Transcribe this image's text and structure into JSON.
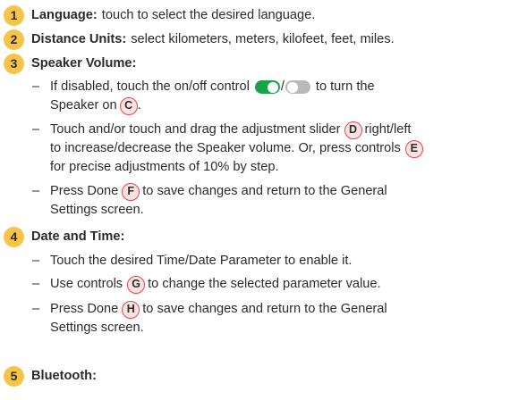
{
  "items": [
    {
      "num": "1",
      "title": "Language:",
      "desc": "touch to select the desired language."
    },
    {
      "num": "2",
      "title": "Distance Units:",
      "desc": "select kilometers, meters, kilofeet, feet, miles."
    },
    {
      "num": "3",
      "title": "Speaker Volume:"
    },
    {
      "num": "4",
      "title": "Date and Time:"
    },
    {
      "num": "5",
      "title": "Bluetooth:"
    }
  ],
  "speaker": {
    "b1": {
      "p1": "If disabled, touch the on/off control",
      "slash": "/",
      "p2": "to turn the",
      "p3": "Speaker on",
      "c": "C",
      "end": "."
    },
    "b2": {
      "p1": "Touch and/or touch and drag the adjustment slider",
      "d": "D",
      "p2": "right/left",
      "p3": "to increase/decrease the Speaker volume. Or, press controls",
      "e": "E",
      "p4": "for precise adjustments of 10% by step."
    },
    "b3": {
      "p1": "Press Done",
      "f": "F",
      "p2": "to save changes and return to the General",
      "p3": "Settings screen."
    }
  },
  "datetime": {
    "b1": "Touch the desired Time/Date Parameter to enable it.",
    "b2": {
      "p1": "Use controls",
      "g": "G",
      "p2": "to change the selected parameter value."
    },
    "b3": {
      "p1": "Press Done",
      "h": "H",
      "p2": "to save changes and return to the General",
      "p3": "Settings screen."
    }
  },
  "dash": "–",
  "colors": {
    "number_badge": "#f7c44b",
    "callout_border": "#e0474c",
    "callout_fill": "#fde2e2",
    "toggle_on": "#1aa34a",
    "toggle_off": "#b9b9b9"
  }
}
